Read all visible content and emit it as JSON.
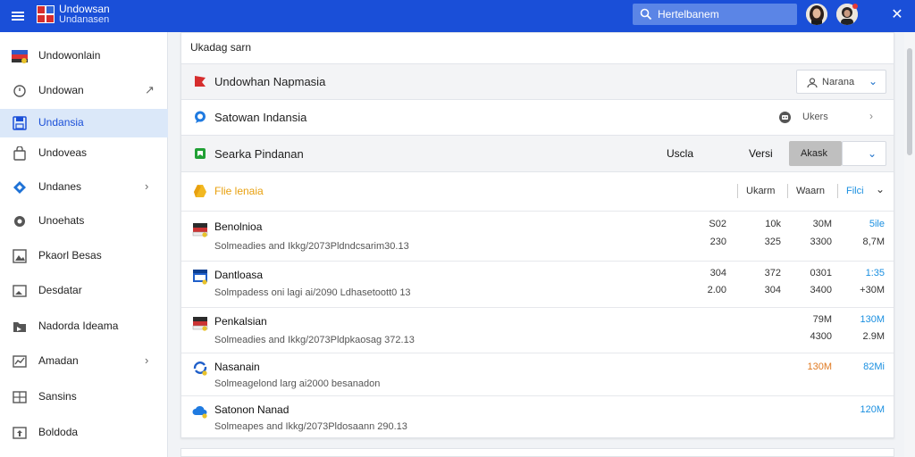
{
  "header": {
    "title": "Undowsan",
    "subtitle": "Undanasen",
    "search_placeholder": "Hertelbanem",
    "close_glyph": "✕"
  },
  "sidebar": {
    "items": [
      {
        "label": "Undowonlain",
        "icon": "flag-icon"
      },
      {
        "label": "Undowan",
        "icon": "clock-icon",
        "chevron": "↗"
      },
      {
        "label": "Undansia",
        "icon": "save-icon",
        "active": true
      },
      {
        "label": "Undoveas",
        "icon": "bag-icon"
      },
      {
        "label": "Undanes",
        "icon": "diamond-icon",
        "chevron": "›"
      },
      {
        "label": "Unoehats",
        "icon": "settings-icon"
      },
      {
        "label": "Pkaorl Besas",
        "icon": "image-icon"
      },
      {
        "label": "Desdatar",
        "icon": "photo-icon"
      },
      {
        "label": "Nadorda Ideama",
        "icon": "folder-icon"
      },
      {
        "label": "Amadan",
        "icon": "chart-icon",
        "chevron": "›"
      },
      {
        "label": "Sansins",
        "icon": "grid-icon"
      },
      {
        "label": "Boldoda",
        "icon": "upload-icon"
      }
    ]
  },
  "main": {
    "title": "Ukadag sarn",
    "section1": {
      "label": "Undowhan Napmasia",
      "dropdown": "Narana",
      "dropdown_chev": "⌄"
    },
    "section2": {
      "label": "Satowan Indansia",
      "dropdown": "Ukers",
      "dropdown_chev": "›"
    },
    "section3": {
      "label": "Searka Pindanan",
      "col1": "Uscla",
      "col2": "Versi",
      "button": "Akask",
      "dropdown_chev": "⌄"
    },
    "section4": {
      "label": "Flie lenaia",
      "cols": [
        "Ukarm",
        "Waarn",
        "Filci"
      ],
      "col_chev": "⌄"
    },
    "rows": [
      {
        "name": "Benolnioa",
        "path": "Solmeadies and Ikkg/2073Pldndcsarim30.13",
        "v1": [
          "S02",
          "230"
        ],
        "v2": [
          "10k",
          "325"
        ],
        "v3": [
          "30M",
          "3300"
        ],
        "v4": [
          "5ile",
          "8,7M"
        ]
      },
      {
        "name": "Dantloasa",
        "path": "Solmpadess oni lagi ai/2090 Ldhasetoott0 13",
        "v1": [
          "304",
          "2.00"
        ],
        "v2": [
          "372",
          "304"
        ],
        "v3": [
          "0301",
          "3400"
        ],
        "v4": [
          "1:35",
          "+30M"
        ]
      },
      {
        "name": "Penkalsian",
        "path": "Solmeadies and Ikkg/2073Pldpkaosag 372.13",
        "v3": [
          "79M",
          "4300"
        ],
        "v4": [
          "130M",
          "2.9M"
        ]
      },
      {
        "name": "Nasanain",
        "path": "Solmeagelond larg ai2000 besanadon",
        "v3": [
          "130M"
        ],
        "v4": [
          "82Mi"
        ]
      },
      {
        "name": "Satonon Nanad",
        "path": "Solmeapes and Ikkg/2073Pldosaann 290.13",
        "v4": [
          "120M"
        ]
      }
    ]
  },
  "colors": {
    "brand": "#1a4fd8",
    "active_bg": "#dbe8f9",
    "accent_blue": "#1a8fe0",
    "accent_orange": "#e07a22"
  }
}
